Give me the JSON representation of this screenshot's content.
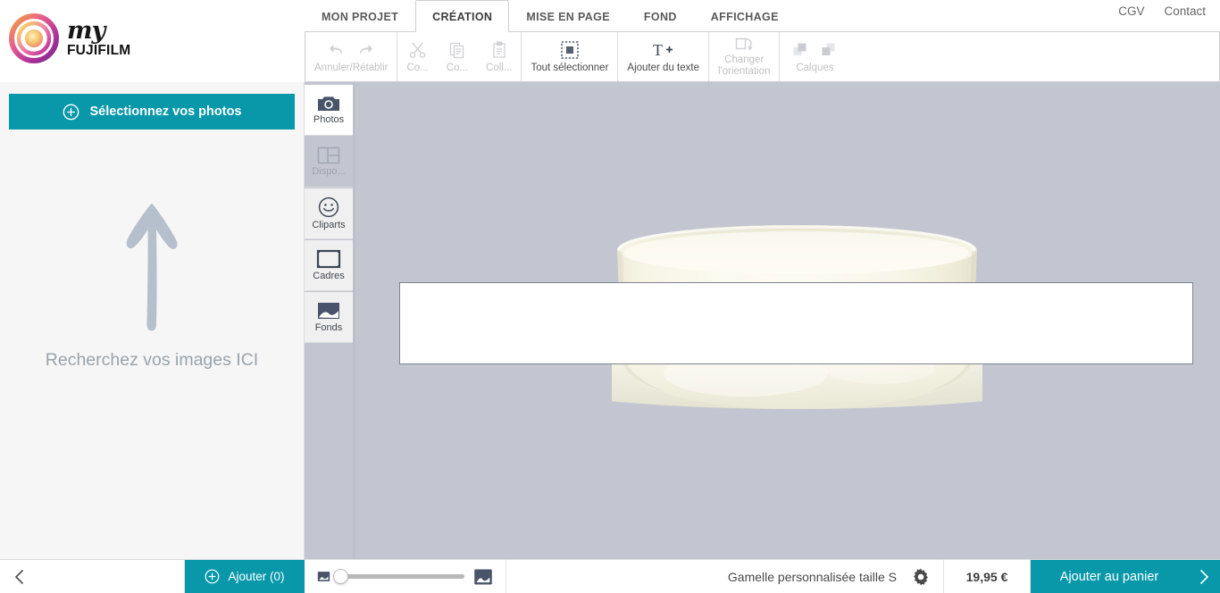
{
  "header": {
    "logo_script": "my",
    "logo_brand": "FUJIFILM",
    "links": [
      {
        "label": "CGV",
        "name": "cgv-link"
      },
      {
        "label": "Contact",
        "name": "contact-link"
      }
    ]
  },
  "tabs": [
    {
      "label": "MON PROJET",
      "name": "tab-mon-projet",
      "active": false
    },
    {
      "label": "CRÉATION",
      "name": "tab-creation",
      "active": true
    },
    {
      "label": "MISE EN PAGE",
      "name": "tab-mise-en-page",
      "active": false
    },
    {
      "label": "FOND",
      "name": "tab-fond",
      "active": false
    },
    {
      "label": "AFFICHAGE",
      "name": "tab-affichage",
      "active": false
    }
  ],
  "ribbon": {
    "undo_redo_label": "Annuler/Rétablir",
    "undo_icon": "undo-arrow-icon",
    "redo_icon": "redo-arrow-icon",
    "cut_label": "Co...",
    "copy_label": "Co...",
    "paste_label": "Coll...",
    "select_all_label": "Tout sélectionner",
    "add_text_label": "Ajouter du texte",
    "change_orientation_label": "Changer\nl'orientation",
    "layers_label": "Calques"
  },
  "left_panel": {
    "select_photos_label": "Sélectionnez vos photos",
    "hint_text": "Recherchez vos images ICI",
    "arrow_icon": "arrow-up-icon"
  },
  "rail": [
    {
      "label": "Photos",
      "name": "rail-item-photos",
      "icon": "camera-icon",
      "state": "active"
    },
    {
      "label": "Dispo...",
      "name": "rail-item-dispositions",
      "icon": "layout-icon",
      "state": "disabled"
    },
    {
      "label": "Cliparts",
      "name": "rail-item-cliparts",
      "icon": "smiley-icon",
      "state": "normal"
    },
    {
      "label": "Cadres",
      "name": "rail-item-cadres",
      "icon": "frame-icon",
      "state": "normal"
    },
    {
      "label": "Fonds",
      "name": "rail-item-fonds",
      "icon": "background-icon",
      "state": "normal"
    }
  ],
  "canvas": {
    "product": "ceramic-bowl",
    "background_color": "#c3c6d0",
    "bowl_color": "#f7f6e8",
    "edit_area_border": "#7e838d"
  },
  "bottom_bar": {
    "back_icon": "chevron-left-icon",
    "add_label": "Ajouter (0)",
    "zoom_small_icon": "image-small-icon",
    "zoom_large_icon": "image-large-icon",
    "zoom_value": 0,
    "product_name": "Gamelle personnalisée taille S",
    "settings_icon": "gear-icon",
    "price": "19,95 €",
    "cart_label": "Ajouter au panier",
    "next_icon": "chevron-right-icon"
  },
  "colors": {
    "accent": "#0898aa",
    "canvas_bg": "#c3c6d0",
    "panel_bg": "#f6f6f6"
  }
}
